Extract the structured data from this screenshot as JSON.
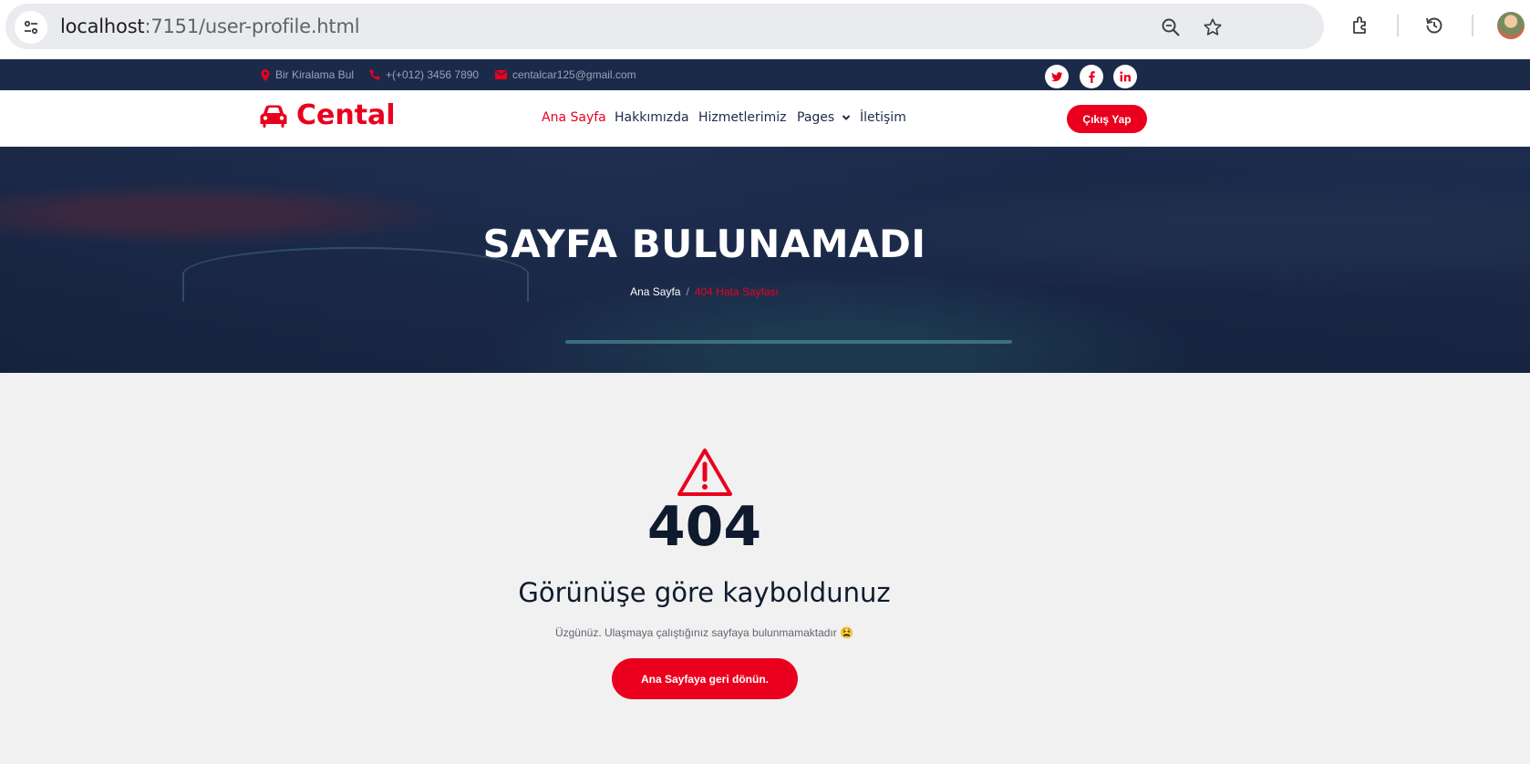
{
  "browser": {
    "url_host": "localhost",
    "url_path": ":7151/user-profile.html"
  },
  "topbar": {
    "address": "Bir Kiralama Bul",
    "phone": "+(+012) 3456 7890",
    "email": "centalcar125@gmail.com",
    "social": [
      "twitter",
      "facebook",
      "linkedin"
    ]
  },
  "navbar": {
    "brand": "Cental",
    "links": [
      {
        "label": "Ana Sayfa",
        "active": true
      },
      {
        "label": "Hakkımızda"
      },
      {
        "label": "Hizmetlerimiz"
      },
      {
        "label": "Pages"
      },
      {
        "label": "İletişim"
      }
    ],
    "logout_label": "Çıkış Yap"
  },
  "hero": {
    "title": "SAYFA BULUNAMADI",
    "breadcrumb_home": "Ana Sayfa",
    "breadcrumb_sep": "/",
    "breadcrumb_current": "404 Hata Sayfası"
  },
  "error": {
    "code": "404",
    "subtitle": "Görünüşe göre kayboldunuz",
    "message": "Üzgünüz. Ulaşmaya çalıştığınız sayfaya bulunmamaktadır 😫",
    "button_label": "Ana Sayfaya geri dönün."
  },
  "colors": {
    "accent": "#ea001e",
    "navy": "#1c2a4a",
    "background": "#f1f1f1"
  }
}
